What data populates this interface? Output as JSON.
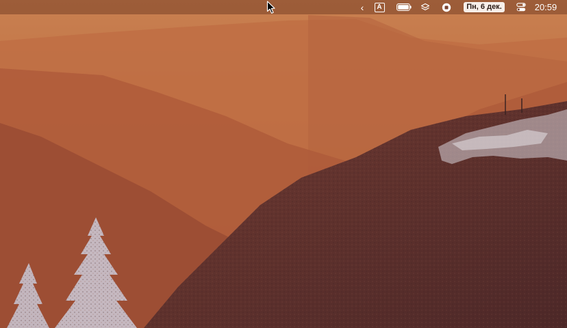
{
  "menubar": {
    "chevron_icon": "chevron-left-icon",
    "input_source_label": "A",
    "battery_icon": "battery-icon",
    "layers_icon": "layers-icon",
    "record_icon": "stop-record-icon",
    "date": "Пн, 6 дек.",
    "control_center_icon": "control-center-icon",
    "time": "20:59"
  },
  "colors": {
    "sky": "#c07a4c",
    "mountain_far": "#b05d3a",
    "mountain_near": "#5a2e2c",
    "snow": "#d9d7df"
  }
}
